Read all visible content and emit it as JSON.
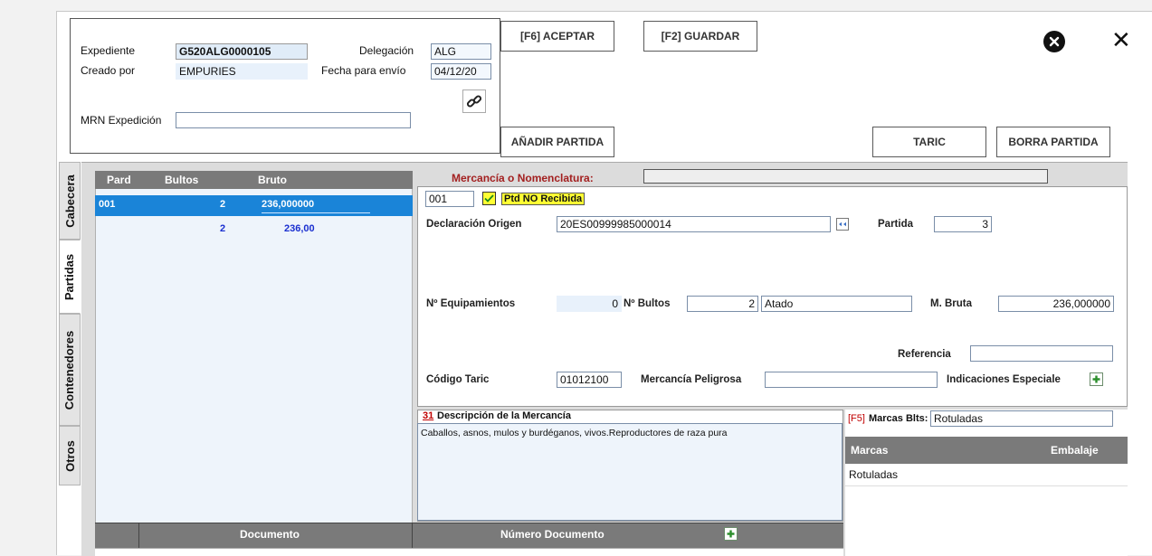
{
  "header": {
    "expediente_label": "Expediente",
    "expediente_value": "G520ALG0000105",
    "delegacion_label": "Delegación",
    "delegacion_value": "ALG",
    "creado_label": "Creado por",
    "creado_value": "EMPURIES",
    "fecha_label": "Fecha para envío",
    "fecha_value": "04/12/20",
    "mrn_label": "MRN Expedición",
    "mrn_value": ""
  },
  "toolbar": {
    "aceptar": "[F6] ACEPTAR",
    "guardar": "[F2] GUARDAR",
    "anadir": "AÑADIR PARTIDA",
    "taric": "TARIC",
    "borra": "BORRA PARTIDA",
    "close_symbol": "✕"
  },
  "tabs": [
    "Cabecera",
    "Partidas",
    "Contenedores",
    "Otros"
  ],
  "partidas_list": {
    "columns": [
      "Pard",
      "Bultos",
      "Bruto"
    ],
    "rows": [
      {
        "pard": "001",
        "bultos": "2",
        "bruto": "236,000000"
      }
    ],
    "totals": {
      "bultos": "2",
      "bruto": "236,00"
    }
  },
  "detail": {
    "mercancia_label": "Mercancía o Nomenclatura:",
    "mercancia_value": "",
    "partida_num": "001",
    "ptd_label": "Ptd NO Recibida",
    "decl_origen_label": "Declaración Origen",
    "decl_origen_value": "20ES00999985000014",
    "partida_label": "Partida",
    "partida_value": "3",
    "equip_label": "Nº Equipamientos",
    "equip_value": "0",
    "bultos_label": "Nº Bultos",
    "bultos_value": "2",
    "bultos_tipo": "Atado",
    "mbruta_label": "M. Bruta",
    "mbruta_value": "236,000000",
    "referencia_label": "Referencia",
    "referencia_value": "",
    "taric_label": "Código Taric",
    "taric_value": "01012100",
    "peligrosa_label": "Mercancía Peligrosa",
    "peligrosa_value": "",
    "indicaciones_label": "Indicaciones Especiale"
  },
  "descripcion": {
    "num": "31",
    "label": "Descripción de la Mercancía",
    "text": "Caballos, asnos, mulos y burdéganos, vivos.Reproductores de raza pura"
  },
  "marcas": {
    "f5": "[F5]",
    "label": "Marcas Blts:",
    "value": "Rotuladas",
    "columns": [
      "Marcas",
      "Embalaje"
    ],
    "rows": [
      "Rotuladas"
    ]
  },
  "documentos": {
    "columns": [
      "Documento",
      "Número Documento"
    ]
  }
}
